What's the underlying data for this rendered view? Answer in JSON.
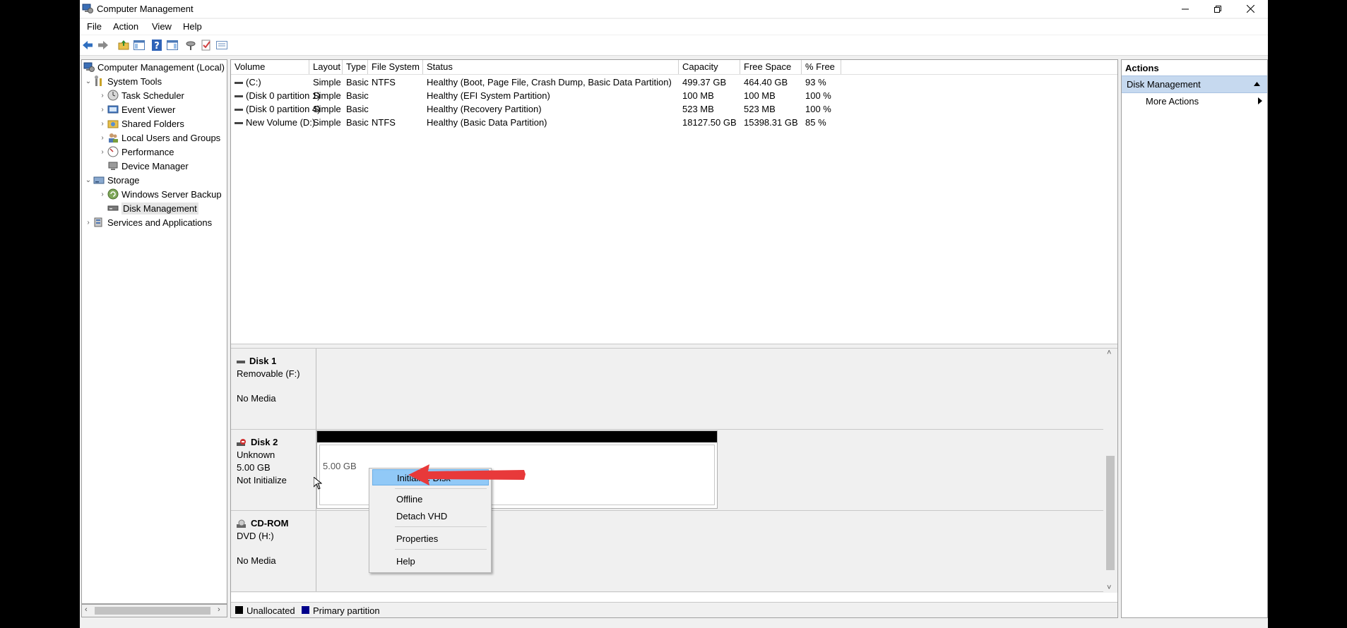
{
  "window": {
    "title": "Computer Management"
  },
  "menu": [
    "File",
    "Action",
    "View",
    "Help"
  ],
  "toolbar": [
    "back-icon",
    "forward-icon",
    "up-folder-icon",
    "show-hide-tree-icon",
    "help-icon",
    "show-hide-action-pane-icon",
    "rescan-icon",
    "properties-icon",
    "extra-view-icon"
  ],
  "tree": {
    "root": "Computer Management (Local)",
    "system_tools": "System Tools",
    "task_scheduler": "Task Scheduler",
    "event_viewer": "Event Viewer",
    "shared_folders": "Shared Folders",
    "local_users": "Local Users and Groups",
    "performance": "Performance",
    "device_manager": "Device Manager",
    "storage": "Storage",
    "backup": "Windows Server Backup",
    "disk_management": "Disk Management",
    "services": "Services and Applications"
  },
  "volumes": {
    "columns": [
      "Volume",
      "Layout",
      "Type",
      "File System",
      "Status",
      "Capacity",
      "Free Space",
      "% Free"
    ],
    "rows": [
      [
        "(C:)",
        "Simple",
        "Basic",
        "NTFS",
        "Healthy (Boot, Page File, Crash Dump, Basic Data Partition)",
        "499.37 GB",
        "464.40 GB",
        "93 %"
      ],
      [
        "(Disk 0 partition 1)",
        "Simple",
        "Basic",
        "",
        "Healthy (EFI System Partition)",
        "100 MB",
        "100 MB",
        "100 %"
      ],
      [
        "(Disk 0 partition 4)",
        "Simple",
        "Basic",
        "",
        "Healthy (Recovery Partition)",
        "523 MB",
        "523 MB",
        "100 %"
      ],
      [
        "New Volume (D:)",
        "Simple",
        "Basic",
        "NTFS",
        "Healthy (Basic Data Partition)",
        "18127.50 GB",
        "15398.31 GB",
        "85 %"
      ]
    ]
  },
  "disks": {
    "disk1": {
      "name": "Disk 1",
      "type": "Removable (F:)",
      "media": "No Media"
    },
    "disk2": {
      "name": "Disk 2",
      "type": "Unknown",
      "size": "5.00 GB",
      "state": "Not Initialize",
      "partition_size": "5.00 GB"
    },
    "cdrom": {
      "name": "CD-ROM",
      "type": "DVD (H:)",
      "media": "No Media"
    }
  },
  "legend": {
    "unallocated": "Unallocated",
    "primary": "Primary partition"
  },
  "actions": {
    "header": "Actions",
    "section": "Disk Management",
    "more": "More Actions"
  },
  "context_menu": {
    "initialize": "Initialize Disk",
    "offline": "Offline",
    "detach": "Detach VHD",
    "properties": "Properties",
    "help": "Help"
  },
  "colors": {
    "selection": "#cce8ff",
    "primary_partition": "#00008b",
    "unallocated": "#000000",
    "arrow": "#e8393a"
  }
}
